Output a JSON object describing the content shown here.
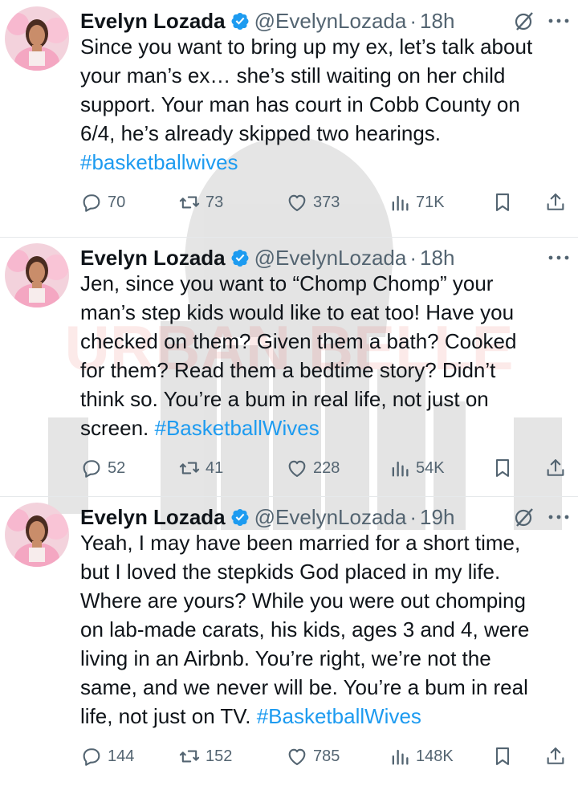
{
  "watermark": {
    "text": "URBAN BELLE"
  },
  "tweets": [
    {
      "name": "Evelyn Lozada",
      "handle": "@EvelynLozada",
      "sep": "·",
      "time": "18h",
      "show_grok": true,
      "lines": [
        "Since you want to bring up my ex, let’s talk about",
        "your man’s ex… she’s still waiting on her child",
        "support. Your man has court in Cobb County on",
        "6/4, he’s already skipped two hearings."
      ],
      "hashtag": "#basketballwives",
      "replies": "70",
      "reposts": "73",
      "likes": "373",
      "views": "71K"
    },
    {
      "name": "Evelyn Lozada",
      "handle": "@EvelynLozada",
      "sep": "·",
      "time": "18h",
      "show_grok": false,
      "lines": [
        "Jen, since you want to “Chomp Chomp” your",
        "man’s step kids would like to eat too! Have you",
        "checked on them? Given them a bath? Cooked",
        "for them? Read them a bedtime story? Didn’t",
        "think so. You’re a bum in real life, not just on",
        "screen."
      ],
      "hashtag": "#BasketballWives",
      "replies": "52",
      "reposts": "41",
      "likes": "228",
      "views": "54K"
    },
    {
      "name": "Evelyn Lozada",
      "handle": "@EvelynLozada",
      "sep": "·",
      "time": "19h",
      "show_grok": true,
      "lines": [
        "Yeah, I may have been married for a short time,",
        "but I loved the stepkids God placed in my life.",
        "Where are yours? While you were out chomping",
        "on lab-made carats, his kids, ages 3 and 4, were",
        "living in an Airbnb. You’re right, we’re not the",
        "same, and we never will be. You’re a bum in real",
        "life, not just on TV."
      ],
      "hashtag": "#BasketballWives",
      "replies": "144",
      "reposts": "152",
      "likes": "785",
      "views": "148K"
    }
  ]
}
